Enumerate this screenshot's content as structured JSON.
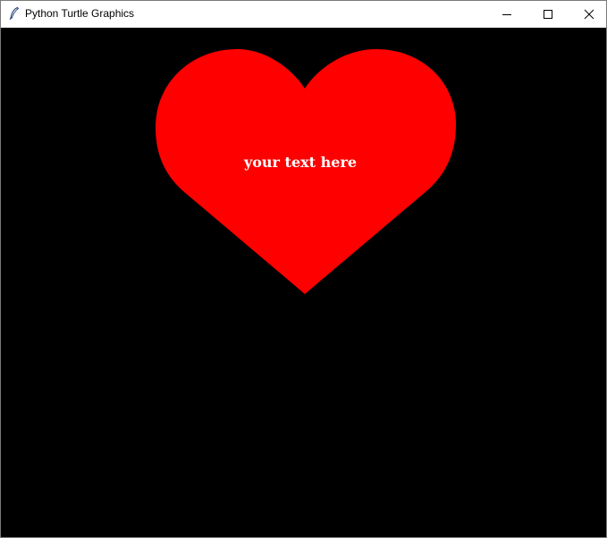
{
  "window": {
    "title": "Python Turtle Graphics"
  },
  "title_buttons": {
    "minimize_icon": "minimize-icon",
    "maximize_icon": "maximize-icon",
    "close_icon": "close-icon"
  },
  "canvas": {
    "background_color": "#000000",
    "heart": {
      "fill_color": "#ff0000",
      "text": "your text here",
      "text_color": "#ffffff"
    }
  }
}
